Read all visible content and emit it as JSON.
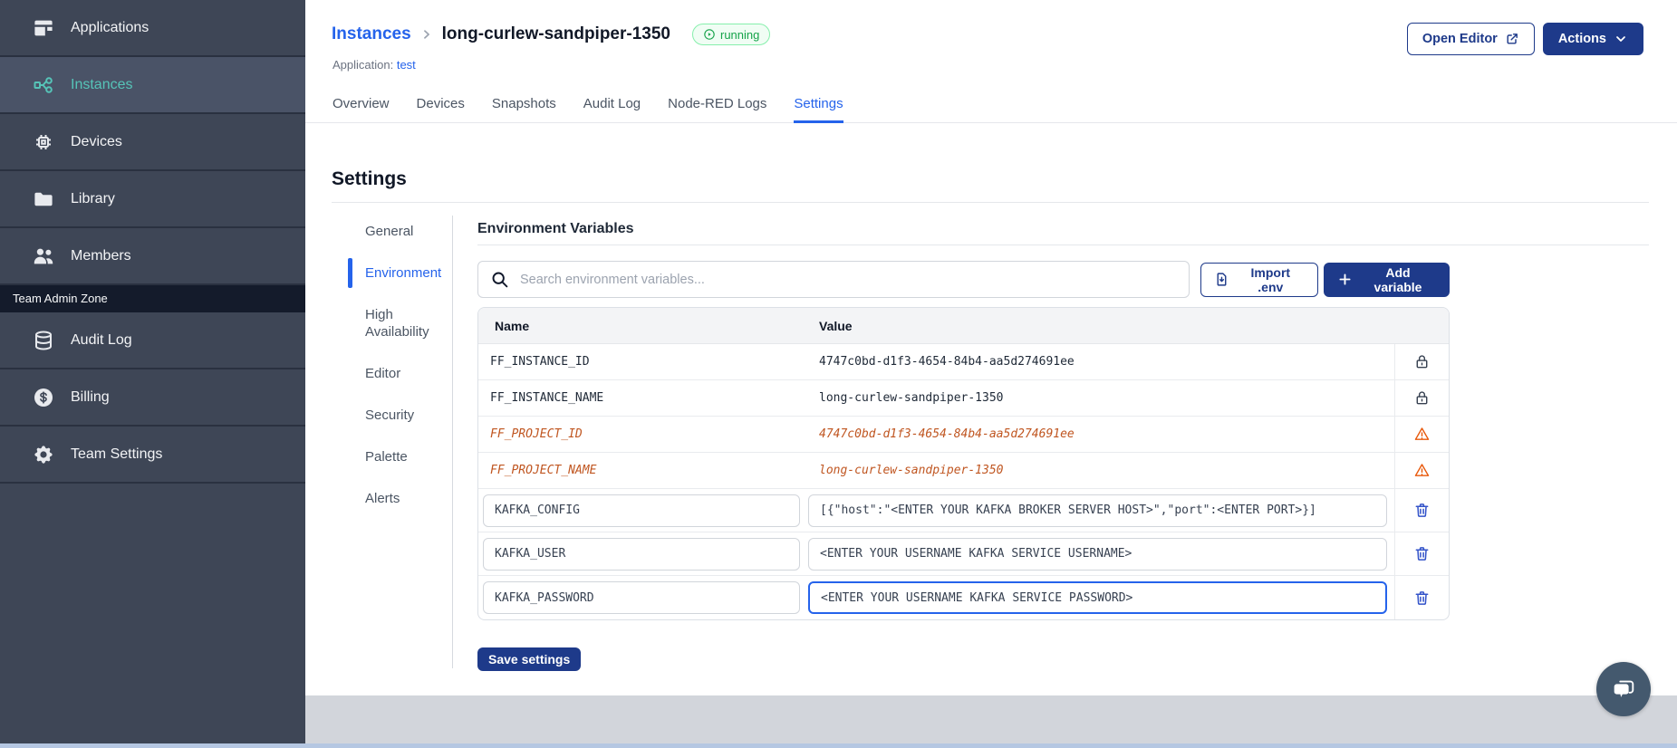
{
  "sidebar": {
    "items": [
      {
        "label": "Applications",
        "icon": "applications-icon",
        "active": false
      },
      {
        "label": "Instances",
        "icon": "instances-icon",
        "active": true
      },
      {
        "label": "Devices",
        "icon": "devices-icon",
        "active": false
      },
      {
        "label": "Library",
        "icon": "library-icon",
        "active": false
      },
      {
        "label": "Members",
        "icon": "members-icon",
        "active": false
      }
    ],
    "section_label": "Team Admin Zone",
    "admin_items": [
      {
        "label": "Audit Log",
        "icon": "audit-log-icon"
      },
      {
        "label": "Billing",
        "icon": "billing-icon"
      },
      {
        "label": "Team Settings",
        "icon": "team-settings-icon"
      }
    ]
  },
  "header": {
    "breadcrumb_parent": "Instances",
    "instance_name": "long-curlew-sandpiper-1350",
    "status": "running",
    "application_label": "Application:",
    "application_name": "test",
    "open_editor_label": "Open Editor",
    "actions_label": "Actions"
  },
  "tabs": {
    "items": [
      "Overview",
      "Devices",
      "Snapshots",
      "Audit Log",
      "Node-RED Logs",
      "Settings"
    ],
    "active": "Settings"
  },
  "settings": {
    "title": "Settings",
    "nav": {
      "items": [
        "General",
        "Environment",
        "High Availability",
        "Editor",
        "Security",
        "Palette",
        "Alerts"
      ],
      "active": "Environment"
    },
    "env": {
      "title": "Environment Variables",
      "search_placeholder": "Search environment variables...",
      "import_label": "Import .env",
      "add_label": "Add variable",
      "save_label": "Save settings",
      "columns": {
        "name": "Name",
        "value": "Value"
      },
      "rows": [
        {
          "name": "FF_INSTANCE_ID",
          "value": "4747c0bd-d1f3-4654-84b4-aa5d274691ee",
          "type": "locked"
        },
        {
          "name": "FF_INSTANCE_NAME",
          "value": "long-curlew-sandpiper-1350",
          "type": "locked"
        },
        {
          "name": "FF_PROJECT_ID",
          "value": "4747c0bd-d1f3-4654-84b4-aa5d274691ee",
          "type": "deprecated"
        },
        {
          "name": "FF_PROJECT_NAME",
          "value": "long-curlew-sandpiper-1350",
          "type": "deprecated"
        },
        {
          "name": "KAFKA_CONFIG",
          "value": "[{\"host\":\"<ENTER YOUR KAFKA BROKER SERVER HOST>\",\"port\":<ENTER PORT>}]",
          "type": "editable",
          "focused": false
        },
        {
          "name": "KAFKA_USER",
          "value": "<ENTER YOUR USERNAME KAFKA SERVICE USERNAME>",
          "type": "editable",
          "focused": false
        },
        {
          "name": "KAFKA_PASSWORD",
          "value": "<ENTER YOUR USERNAME KAFKA SERVICE PASSWORD>",
          "type": "editable",
          "focused": true
        }
      ]
    }
  },
  "colors": {
    "primary_navy": "#1e3a8a",
    "link_blue": "#2563eb",
    "sidebar_teal": "#56c4b8",
    "deprecated_orange": "#c05621",
    "status_green": "#16a34a",
    "trash_blue": "#3353c9"
  }
}
